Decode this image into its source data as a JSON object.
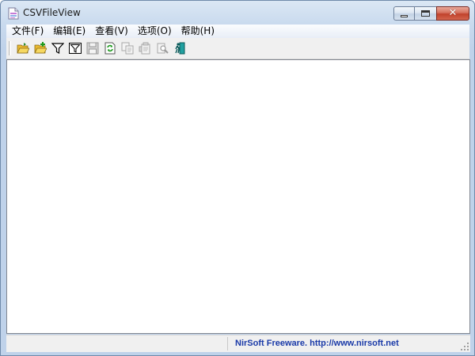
{
  "window": {
    "title": "CSVFileView"
  },
  "menubar": {
    "items": [
      "文件(F)",
      "编辑(E)",
      "查看(V)",
      "选项(O)",
      "帮助(H)"
    ]
  },
  "toolbar": {
    "buttons": [
      {
        "icon": "open-folder-icon",
        "enabled": true
      },
      {
        "icon": "open-folder-plus-icon",
        "enabled": true
      },
      {
        "icon": "filter-icon",
        "enabled": true
      },
      {
        "icon": "advanced-filter-icon",
        "enabled": true
      },
      {
        "icon": "save-icon",
        "enabled": false
      },
      {
        "icon": "refresh-icon",
        "enabled": true
      },
      {
        "icon": "copy-icon",
        "enabled": false
      },
      {
        "icon": "properties-icon",
        "enabled": false
      },
      {
        "icon": "find-icon",
        "enabled": false
      },
      {
        "icon": "exit-icon",
        "enabled": true
      }
    ]
  },
  "statusbar": {
    "panel1": "",
    "link": "NirSoft Freeware.  http://www.nirsoft.net"
  },
  "colors": {
    "link": "#1a3aa8",
    "close_button": "#c1412b"
  }
}
